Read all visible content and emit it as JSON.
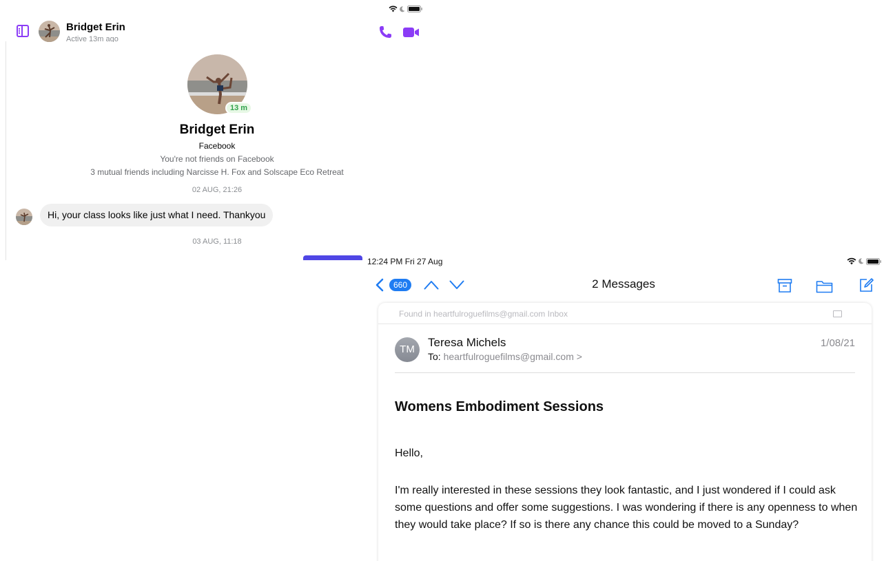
{
  "messenger": {
    "contact_name": "Bridget Erin",
    "contact_status": "Active 13m ago",
    "profile": {
      "name": "Bridget Erin",
      "platform": "Facebook",
      "friend_status": "You're not friends on Facebook",
      "mutual_friends": "3 mutual friends including Narcisse H. Fox and Solscape Eco Retreat",
      "active_badge": "13 m"
    },
    "messages": [
      {
        "timestamp": "02 AUG, 21:26",
        "text": "Hi, your class looks like just what I need. Thankyou"
      },
      {
        "timestamp": "03 AUG, 11:18"
      }
    ],
    "accent_color": "#8b3cf6"
  },
  "mail": {
    "status_time": "12:24 PM   Fri 27 Aug",
    "back_badge": "660",
    "title": "2 Messages",
    "found_in": "Found in heartfulroguefilms@gmail.com Inbox",
    "sender_initials": "TM",
    "sender_name": "Teresa Michels",
    "to_label": "To:",
    "recipient": "heartfulroguefilms@gmail.com >",
    "date": "1/08/21",
    "subject": "Womens Embodiment Sessions",
    "greeting": "Hello,",
    "body": "I'm really interested in these sessions they look fantastic, and I just wondered if I could ask some questions and offer some suggestions. I was wondering if there is any openness to when they would take place? If so is there any chance this could be moved to a Sunday?",
    "accent_color": "#1f7cf2"
  }
}
